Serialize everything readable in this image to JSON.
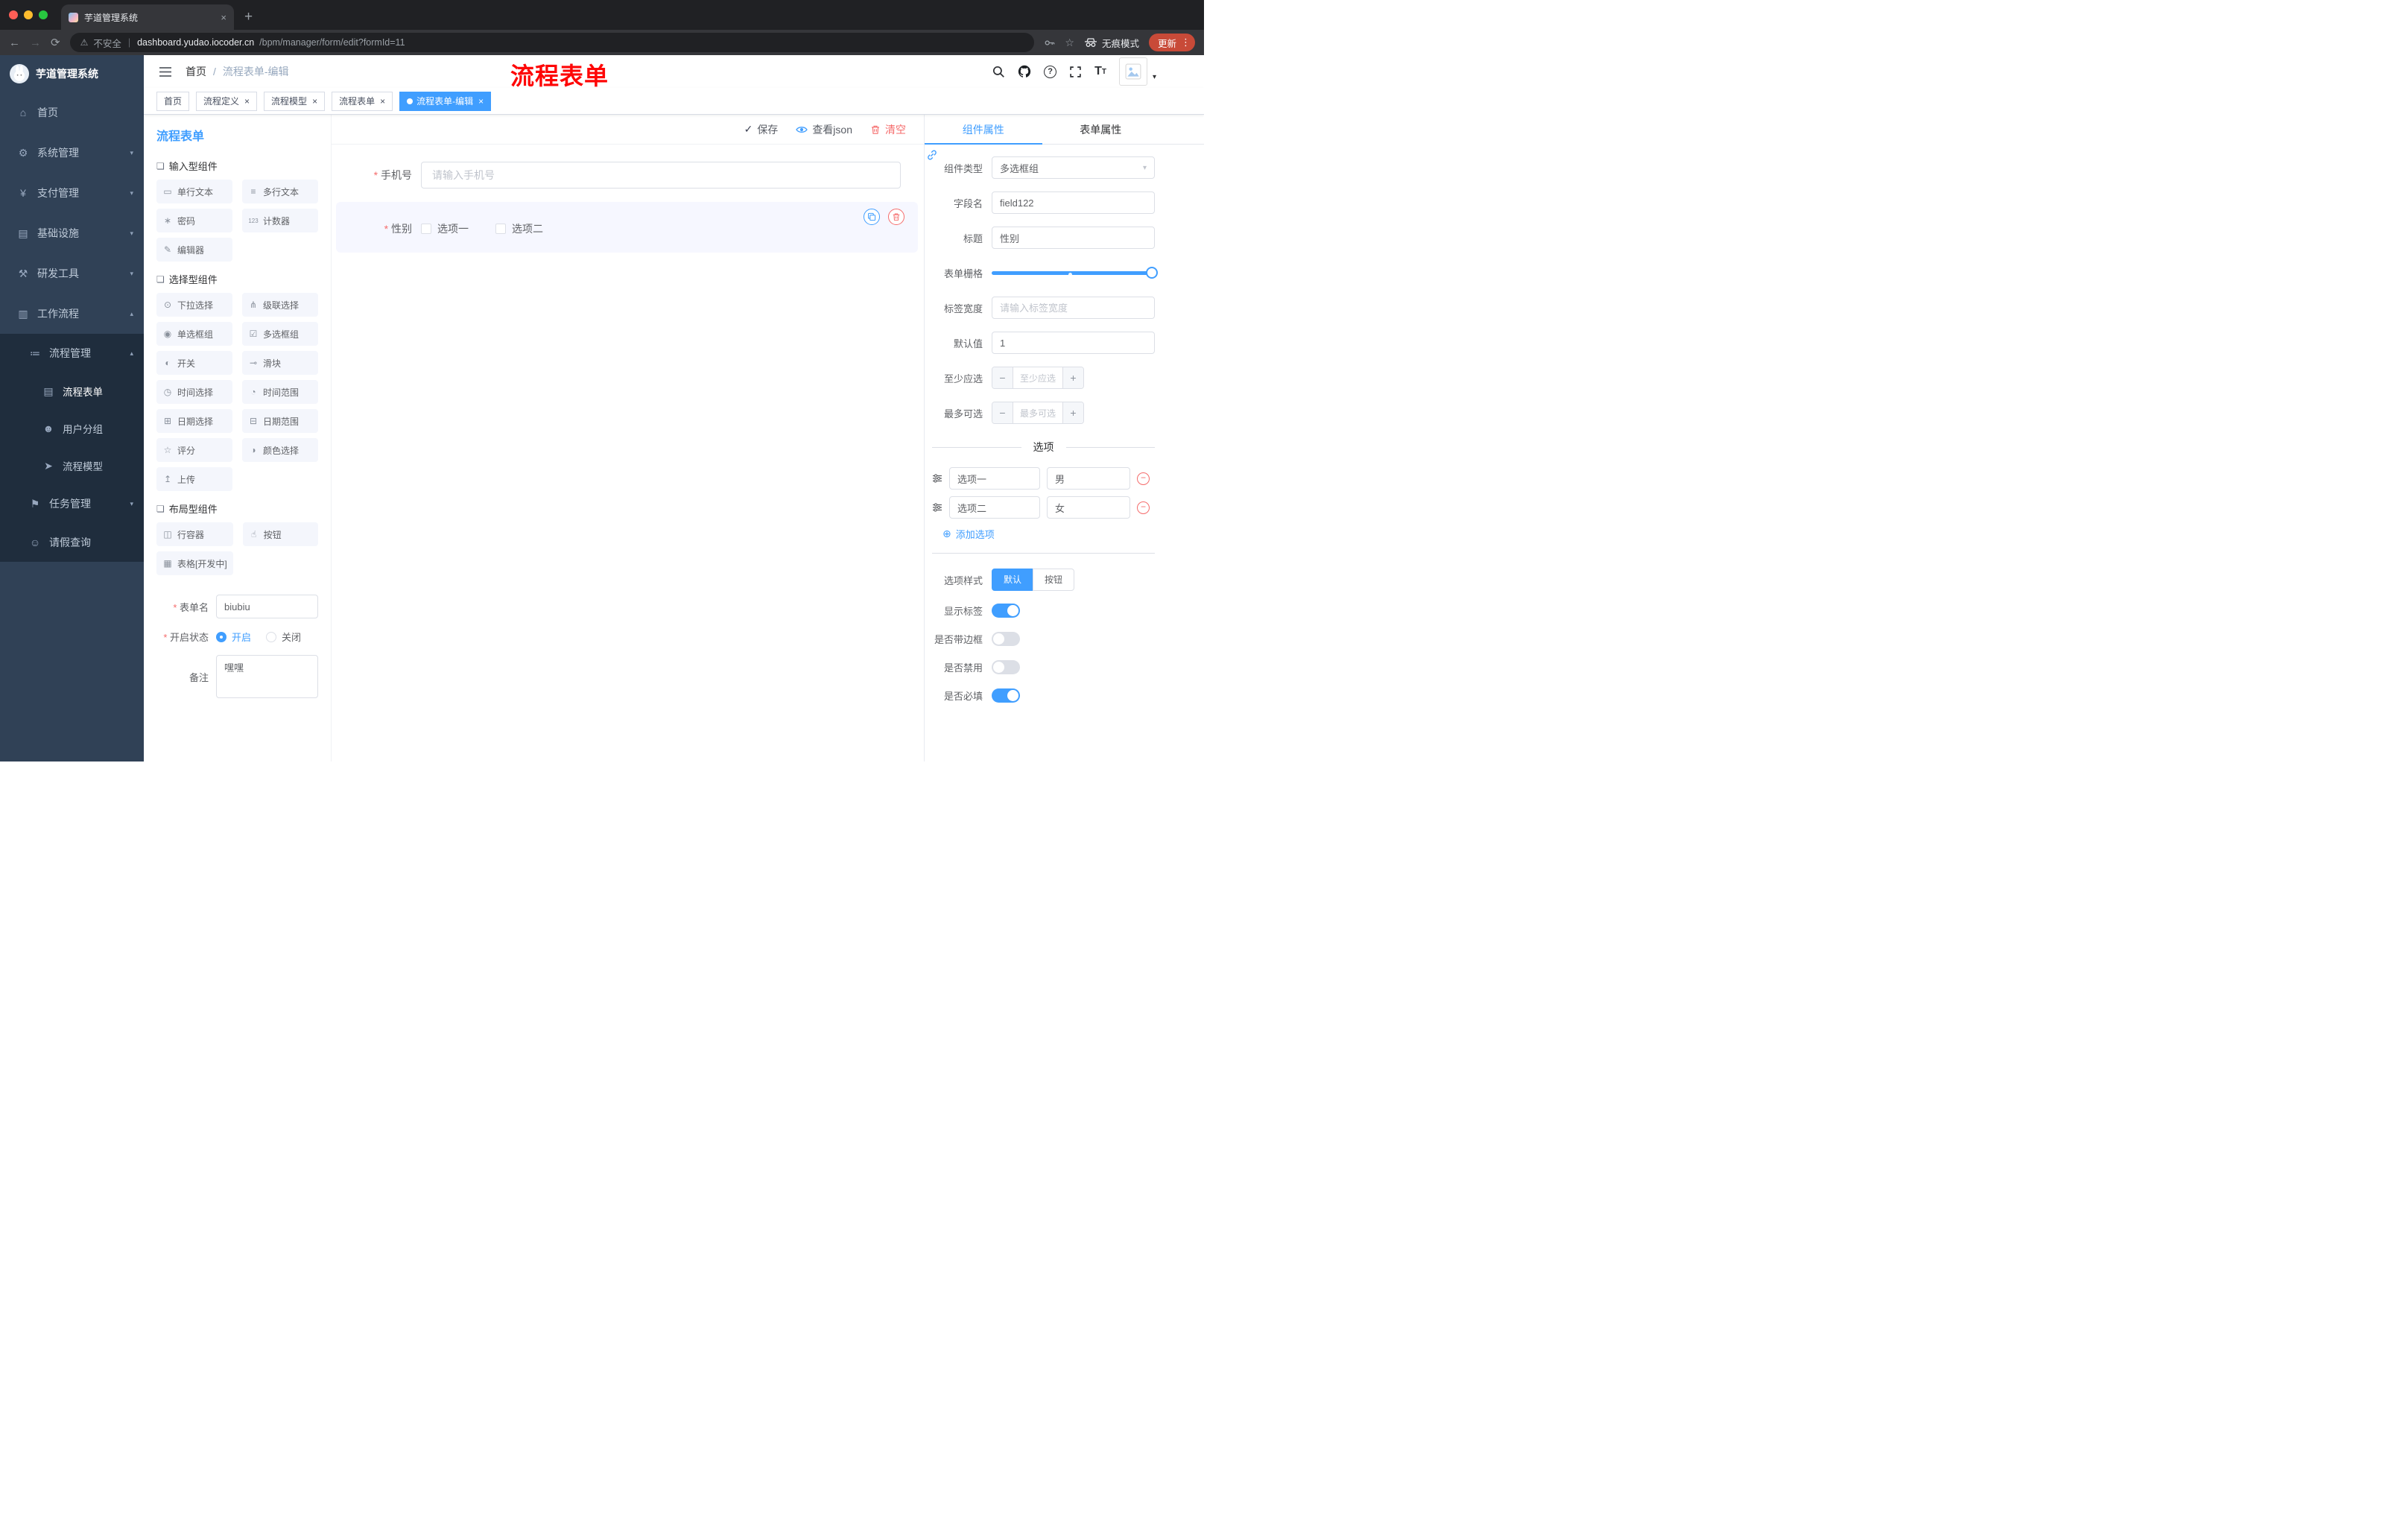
{
  "colors": {
    "accent": "#409eff",
    "danger": "#f56c6c",
    "sidebar_bg": "#304156",
    "submenu_bg": "#1f2d3d",
    "annotation_red": "#fe0606",
    "update_btn": "#c84a38"
  },
  "icons": {
    "back": "←",
    "forward": "→",
    "reload": "⟳",
    "warning": "⚠",
    "divider": "|",
    "star": "☆",
    "menu_dots": "⋮",
    "caret_down": "▾",
    "check": "✓",
    "plus_circle": "⊕",
    "minus": "−",
    "plus": "+",
    "close": "×",
    "question": "?",
    "text_big": "T",
    "text_small": "T",
    "new_tab": "+"
  },
  "browser": {
    "tab_title": "芋道管理系统",
    "security_label": "不安全",
    "url_host": "dashboard.yudao.iocoder.cn",
    "url_path": "/bpm/manager/form/edit?formId=11",
    "incognito_label": "无痕模式",
    "update_label": "更新"
  },
  "sidebar": {
    "logo_title": "芋道管理系统",
    "items": [
      {
        "label": "首页",
        "icon": "⌂",
        "chevron": ""
      },
      {
        "label": "系统管理",
        "icon": "⚙",
        "chevron": "▾"
      },
      {
        "label": "支付管理",
        "icon": "¥",
        "chevron": "▾"
      },
      {
        "label": "基础设施",
        "icon": "▤",
        "chevron": "▾"
      },
      {
        "label": "研发工具",
        "icon": "⚒",
        "chevron": "▾"
      },
      {
        "label": "工作流程",
        "icon": "▥",
        "chevron": "▴"
      },
      {
        "label": "流程管理",
        "icon": "≔",
        "chevron": "▴"
      },
      {
        "label": "流程表单",
        "icon": "▤",
        "chevron": ""
      },
      {
        "label": "用户分组",
        "icon": "☻",
        "chevron": ""
      },
      {
        "label": "流程模型",
        "icon": "➤",
        "chevron": ""
      },
      {
        "label": "任务管理",
        "icon": "⚑",
        "chevron": "▾"
      },
      {
        "label": "请假查询",
        "icon": "☺",
        "chevron": ""
      }
    ]
  },
  "header": {
    "breadcrumb_home": "首页",
    "breadcrumb_sep": "/",
    "breadcrumb_current": "流程表单-编辑",
    "annotation": "流程表单"
  },
  "tagbar": {
    "tags": [
      {
        "label": "首页"
      },
      {
        "label": "流程定义"
      },
      {
        "label": "流程模型"
      },
      {
        "label": "流程表单"
      },
      {
        "label": "流程表单-编辑"
      }
    ]
  },
  "designer": {
    "title": "流程表单",
    "groups": [
      {
        "title": "输入型组件",
        "icon": "❏",
        "items": [
          {
            "label": "单行文本",
            "icon": "▭"
          },
          {
            "label": "多行文本",
            "icon": "≡"
          },
          {
            "label": "密码",
            "icon": "∗"
          },
          {
            "label": "计数器",
            "icon": "123"
          },
          {
            "label": "编辑器",
            "icon": "✎"
          }
        ]
      },
      {
        "title": "选择型组件",
        "icon": "❏",
        "items": [
          {
            "label": "下拉选择",
            "icon": "⊙"
          },
          {
            "label": "级联选择",
            "icon": "⋔"
          },
          {
            "label": "单选框组",
            "icon": "◉"
          },
          {
            "label": "多选框组",
            "icon": "☑"
          },
          {
            "label": "开关",
            "icon": "◐"
          },
          {
            "label": "滑块",
            "icon": "⊸"
          },
          {
            "label": "时间选择",
            "icon": "◷"
          },
          {
            "label": "时间范围",
            "icon": "◔"
          },
          {
            "label": "日期选择",
            "icon": "⊞"
          },
          {
            "label": "日期范围",
            "icon": "⊟"
          },
          {
            "label": "评分",
            "icon": "☆"
          },
          {
            "label": "颜色选择",
            "icon": "◑"
          },
          {
            "label": "上传",
            "icon": "↥"
          }
        ]
      },
      {
        "title": "布局型组件",
        "icon": "❏",
        "items": [
          {
            "label": "行容器",
            "icon": "◫"
          },
          {
            "label": "按钮",
            "icon": "☝"
          },
          {
            "label": "表格[开发中]",
            "icon": "▦"
          }
        ]
      }
    ],
    "settings": {
      "name_label": "表单名",
      "name_value": "biubiu",
      "status_label": "开启状态",
      "status_on": "开启",
      "status_off": "关闭",
      "remark_label": "备注",
      "remark_value": "嘿嘿"
    }
  },
  "canvas": {
    "actions": {
      "save": "保存",
      "view_json": "查看json",
      "clear": "清空"
    },
    "phone": {
      "label": "手机号",
      "placeholder": "请输入手机号"
    },
    "gender": {
      "label": "性别",
      "options": [
        "选项一",
        "选项二"
      ]
    }
  },
  "props": {
    "tab_component": "组件属性",
    "tab_form": "表单属性",
    "type_label": "组件类型",
    "type_value": "多选框组",
    "field_label": "字段名",
    "field_value": "field122",
    "title_label": "标题",
    "title_value": "性别",
    "grid_label": "表单栅格",
    "width_label": "标签宽度",
    "width_placeholder": "请输入标签宽度",
    "default_label": "默认值",
    "default_value": "1",
    "min_label": "至少应选",
    "min_placeholder": "至少应选",
    "max_label": "最多可选",
    "max_placeholder": "最多可选",
    "options_divider": "选项",
    "option_rows": [
      {
        "name": "选项一",
        "value": "男"
      },
      {
        "name": "选项二",
        "value": "女"
      }
    ],
    "add_option": "添加选项",
    "style_label": "选项样式",
    "style_default": "默认",
    "style_button": "按钮",
    "switches": [
      {
        "label": "显示标签",
        "on": true
      },
      {
        "label": "是否带边框",
        "on": false
      },
      {
        "label": "是否禁用",
        "on": false
      },
      {
        "label": "是否必填",
        "on": true
      }
    ]
  }
}
